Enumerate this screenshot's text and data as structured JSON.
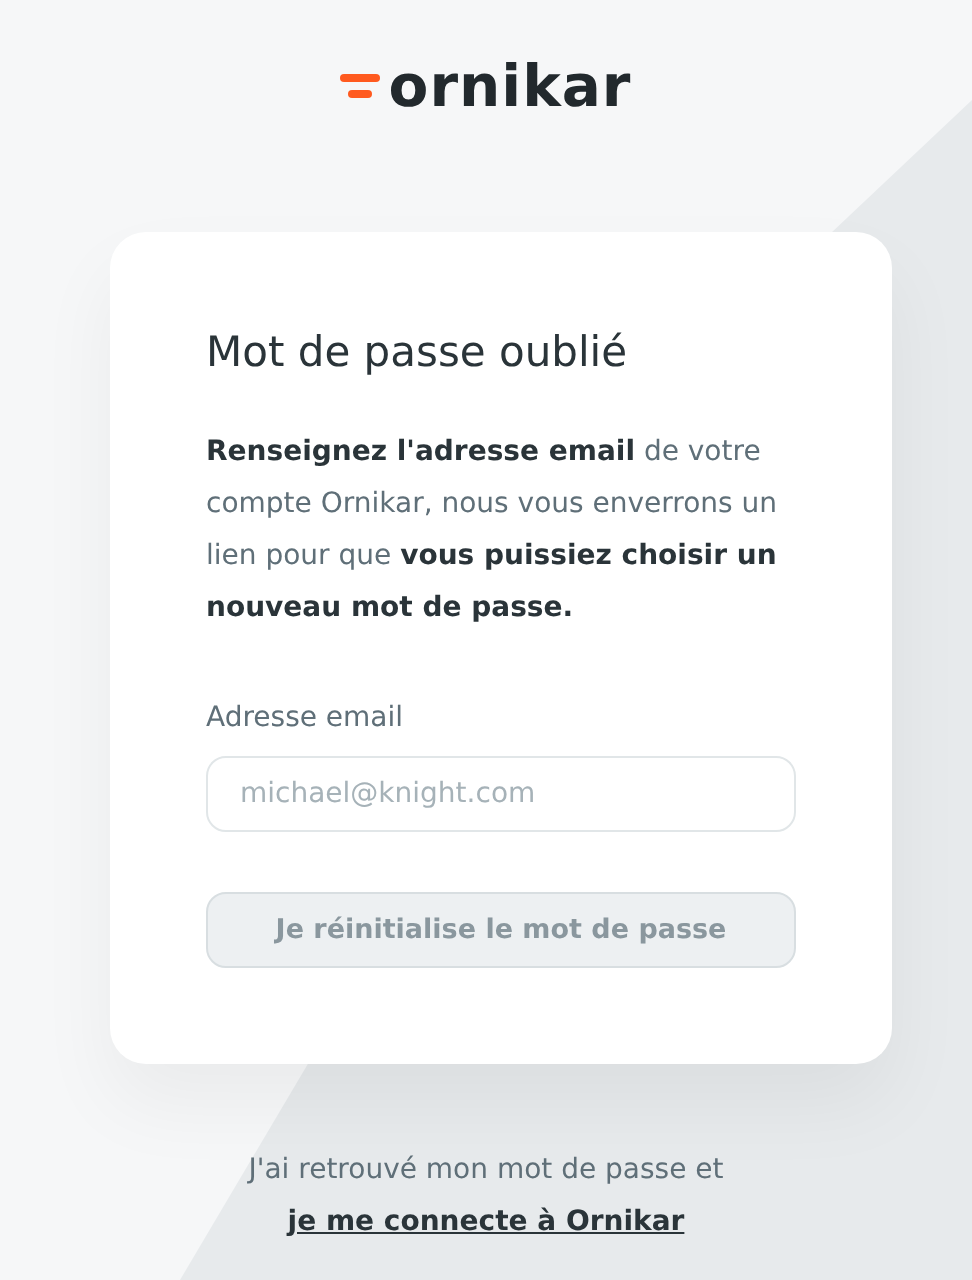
{
  "logo": {
    "text": "ornikar"
  },
  "card": {
    "title": "Mot de passe oublié",
    "intro": "**Renseignez l'adresse email** de votre compte Ornikar, nous vous enverrons un lien pour que **vous puissiez choisir un nouveau mot de passe.**",
    "email_label": "Adresse email",
    "email_field": {
      "placeholder": "michael@knight.com"
    },
    "submit_button": {
      "label": "Je réinitialise le mot de passe",
      "disabled": true
    }
  },
  "footer": {
    "text": "J'ai retrouvé mon mot de passe et",
    "link": "je me connecte à Ornikar"
  }
}
